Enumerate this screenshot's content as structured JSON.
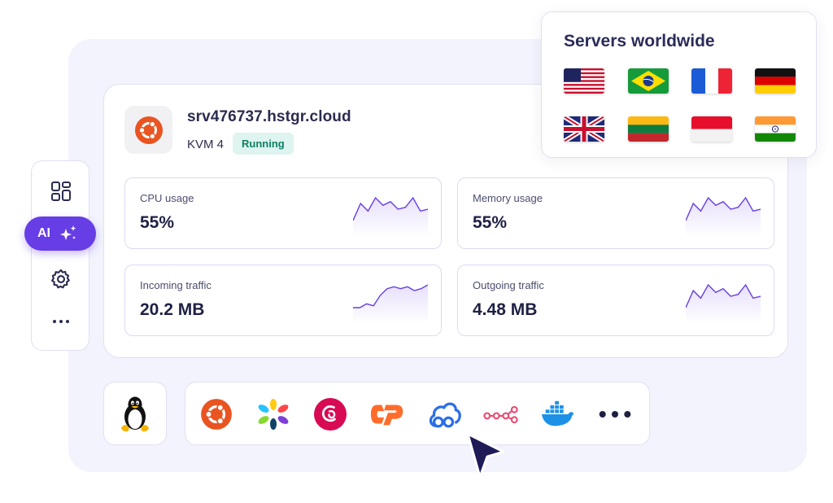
{
  "server": {
    "os_icon": "ubuntu-icon",
    "hostname": "srv476737.hstgr.cloud",
    "plan": "KVM 4",
    "status": "Running",
    "status_color": "#0e7f64"
  },
  "metrics": [
    {
      "label": "CPU usage",
      "value": "55%",
      "sparkline": [
        5,
        14,
        10,
        17,
        13,
        15,
        11,
        12,
        17,
        10,
        11
      ]
    },
    {
      "label": "Memory usage",
      "value": "55%",
      "sparkline": [
        5,
        14,
        10,
        17,
        13,
        15,
        11,
        12,
        17,
        10,
        11
      ]
    },
    {
      "label": "Incoming traffic",
      "value": "20.2 MB",
      "sparkline": [
        0,
        0,
        8,
        4,
        26,
        40,
        44,
        40,
        44,
        36,
        40,
        48
      ]
    },
    {
      "label": "Outgoing traffic",
      "value": "4.48 MB",
      "sparkline": [
        5,
        14,
        10,
        17,
        13,
        15,
        11,
        12,
        17,
        10,
        11
      ]
    }
  ],
  "servers_worldwide": {
    "title": "Servers worldwide",
    "flags": [
      "us-flag",
      "brazil-flag",
      "france-flag",
      "germany-flag",
      "uk-flag",
      "lithuania-flag",
      "indonesia-flag",
      "india-flag"
    ]
  },
  "sidebar": {
    "items": [
      "dashboard-icon",
      "ai-assistant",
      "settings-icon",
      "more-icon"
    ],
    "ai_label": "AI"
  },
  "os_templates": [
    "linux-icon",
    "ubuntu-icon",
    "almalinux-icon",
    "debian-icon",
    "cpanel-icon",
    "cloudpanel-icon",
    "n8n-icon",
    "docker-icon",
    "more-icon"
  ],
  "colors": {
    "accent": "#673de6",
    "sparkline": "#673de6",
    "ubuntu": "#e95420",
    "debian": "#d70a53",
    "cpanel": "#ff6c2c",
    "cloudpanel": "#2a6fe8",
    "n8n": "#ea4b71",
    "docker": "#1d91e6"
  }
}
